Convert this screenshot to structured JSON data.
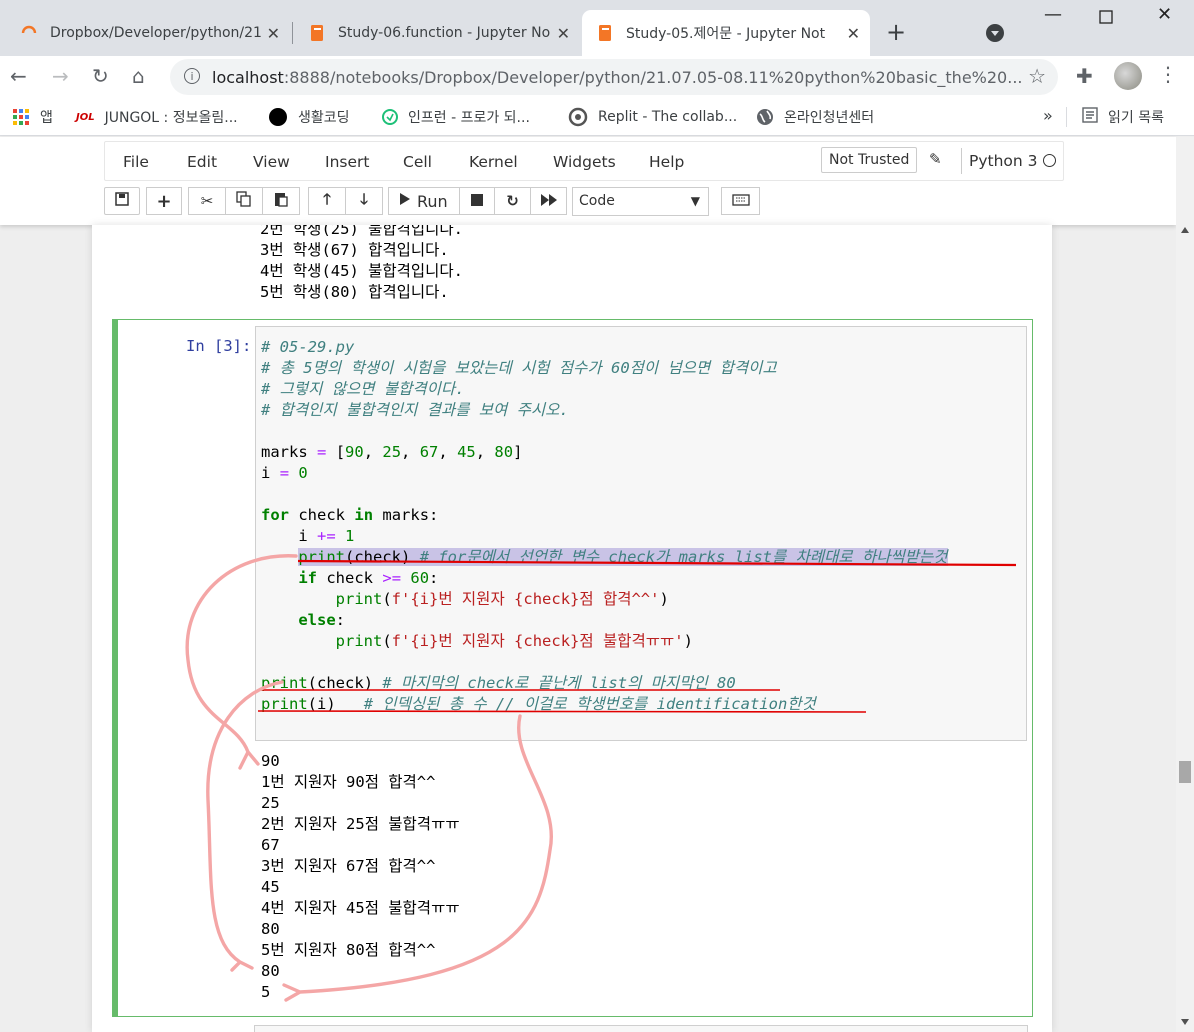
{
  "browser": {
    "tabs": [
      {
        "title": "Dropbox/Developer/python/21",
        "active": false
      },
      {
        "title": "Study-06.function - Jupyter No",
        "active": false
      },
      {
        "title": "Study-05.제어문 - Jupyter Not",
        "active": true
      }
    ],
    "url_host": "localhost",
    "url_rest": ":8888/notebooks/Dropbox/Developer/python/21.07.05-08.11%20python%20basic_the%20...",
    "bookmarks": [
      {
        "icon": "apps-grid-icon",
        "label": "앱"
      },
      {
        "icon": "jungol-icon",
        "label": "JUNGOL : 정보올림..."
      },
      {
        "icon": "black-circle-icon",
        "label": "생활코딩"
      },
      {
        "icon": "inflearn-icon",
        "label": "인프런 - 프로가 되..."
      },
      {
        "icon": "replit-icon",
        "label": "Replit - The collab..."
      },
      {
        "icon": "globe-icon",
        "label": "온라인청년센터"
      }
    ],
    "more": "»",
    "reading_list": "읽기 목록"
  },
  "jupyter": {
    "menu": [
      "File",
      "Edit",
      "View",
      "Insert",
      "Cell",
      "Kernel",
      "Widgets",
      "Help"
    ],
    "not_trusted": "Not Trusted",
    "kernel": "Python 3",
    "run_label": "Run",
    "cell_type": "Code"
  },
  "prev_output": [
    "2번 학생(25) 불합격입니다.",
    "3번 학생(67) 합격입니다.",
    "4번 학생(45) 불합격입니다.",
    "5번 학생(80) 합격입니다."
  ],
  "cell": {
    "prompt": "In [3]:",
    "code": {
      "l1": "# 05-29.py",
      "l2": "# 총 5명의 학생이 시험을 보았는데 시험 점수가 60점이 넘으면 합격이고",
      "l3": "# 그렇지 않으면 불합격이다.",
      "l4": "# 합격인지 불합격인지 결과를 보여 주시오.",
      "marks_var": "marks",
      "marks_vals": [
        "90",
        "25",
        "67",
        "45",
        "80"
      ],
      "i_var": "i",
      "zero": "0",
      "kw_for": "for",
      "kw_in": "in",
      "check_var": "check",
      "plus_eq": "+=",
      "one": "1",
      "print": "print",
      "comment_for": "# for문에서 선언한 변수 check가 marks list를 차례대로 하나씩받는것",
      "kw_if": "if",
      "gte": ">=",
      "sixty": "60",
      "fprint_pass": "f'{i}번 지원자 {check}점 합격^^'",
      "kw_else": "else",
      "fprint_fail": "f'{i}번 지원자 {check}점 불합격ㅠㅠ'",
      "comment_last": "# 마지막의 check로 끝난게 list의 마지막인 80",
      "comment_i": "# 인덱싱된 총 수 // 이걸로 학생번호를 identification한것"
    },
    "output": [
      "90",
      "1번 지원자 90점 합격^^",
      "25",
      "2번 지원자 25점 불합격ㅠㅠ",
      "67",
      "3번 지원자 67점 합격^^",
      "45",
      "4번 지원자 45점 불합격ㅠㅠ",
      "80",
      "5번 지원자 80점 합격^^",
      "80",
      "5"
    ]
  },
  "colors": {
    "cell_border": "#66bb6a",
    "annotation_underline": "#e00000",
    "annotation_ink": "#f4a6a6",
    "highlight": "#c9c3e6"
  }
}
